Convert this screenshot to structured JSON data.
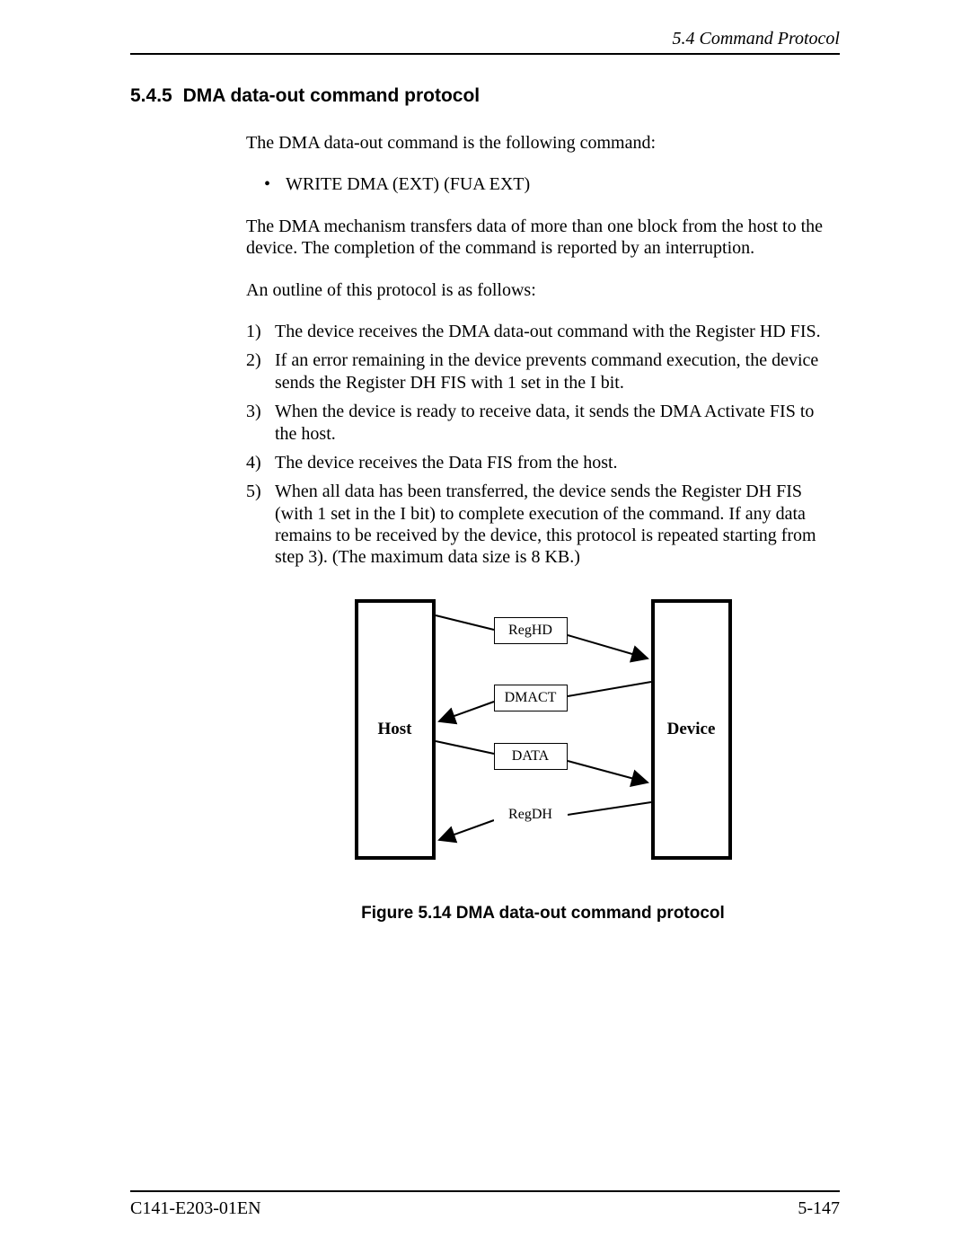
{
  "header": {
    "section_label": "5.4   Command Protocol"
  },
  "section": {
    "number": "5.4.5",
    "title": "DMA data-out command protocol"
  },
  "body": {
    "intro1": "The DMA data-out command is the following command:",
    "bullet1": "WRITE DMA (EXT) (FUA EXT)",
    "intro2": "The DMA mechanism transfers data of more than one block from the host to the device.  The completion of the command is reported by an interruption.",
    "intro3": "An outline of this protocol is as follows:",
    "steps": [
      "The device receives the DMA data-out command with the Register HD FIS.",
      "If an error remaining in the device prevents command execution, the device sends the Register DH FIS with 1 set in the I bit.",
      "When the device is ready to receive data, it sends the DMA Activate FIS to the host.",
      "The device receives the Data FIS from the host.",
      "When all data has been transferred, the device sends the Register DH FIS (with 1 set in the I bit) to complete execution of the command.  If any data remains to be received by the device, this protocol is repeated starting from step 3).  (The maximum data size is 8 KB.)"
    ]
  },
  "figure": {
    "host_label": "Host",
    "device_label": "Device",
    "messages": {
      "reghd": "RegHD",
      "dmact": "DMACT",
      "data": "DATA",
      "regdh": "RegDH"
    },
    "caption": "Figure 5.14  DMA data-out command protocol"
  },
  "footer": {
    "doc_id": "C141-E203-01EN",
    "page": "5-147"
  }
}
